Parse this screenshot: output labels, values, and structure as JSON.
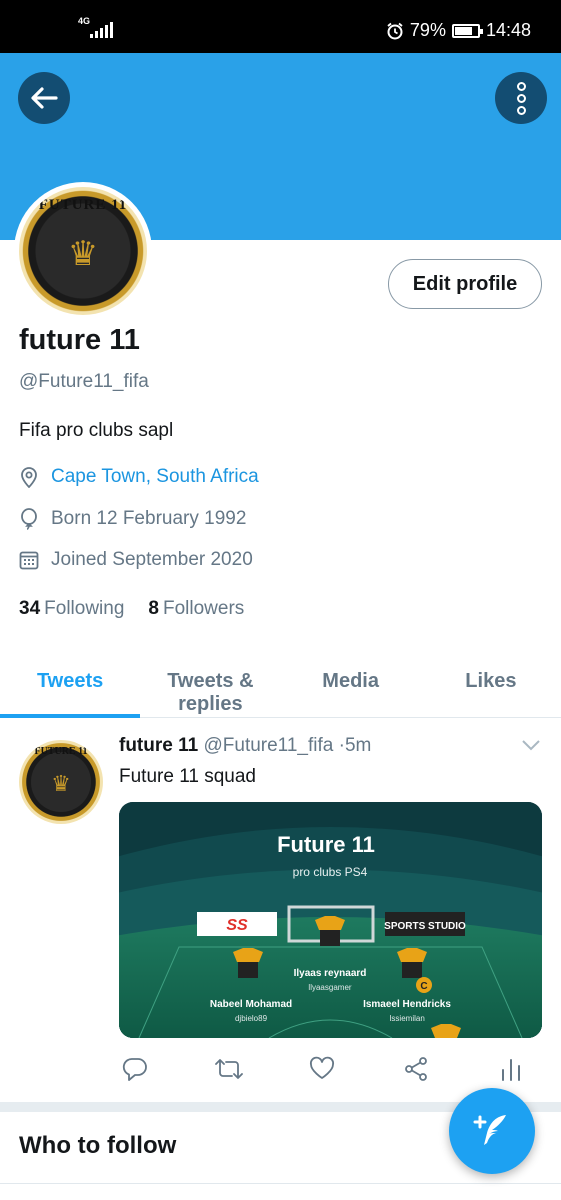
{
  "status_bar": {
    "network": "4G",
    "battery": "79%",
    "battery_level": 0.79,
    "time": "14:48"
  },
  "profile": {
    "name": "future 11",
    "handle": "@Future11_fifa",
    "bio": "Fifa pro clubs sapl",
    "location": "Cape Town, South Africa",
    "born": "Born 12 February 1992",
    "joined": "Joined September 2020",
    "following_count": "34",
    "following_label": "Following",
    "followers_count": "8",
    "followers_label": "Followers",
    "edit_button": "Edit profile",
    "avatar_text": "FUTURE 11"
  },
  "tabs": [
    {
      "label": "Tweets",
      "active": true
    },
    {
      "label": "Tweets & replies",
      "active": false
    },
    {
      "label": "Media",
      "active": false
    },
    {
      "label": "Likes",
      "active": false
    }
  ],
  "tweet": {
    "author": "future 11",
    "handle": "@Future11_fifa",
    "separator": "·",
    "time": "5m",
    "text": "Future 11 squad",
    "media": {
      "title": "Future 11",
      "subtitle": "pro clubs PS4",
      "sponsor_left": "SS",
      "sponsor_right": "SPORTS STUDIO",
      "players": [
        {
          "name": "Ilyaas reynaard",
          "tag": "llyaasgamer"
        },
        {
          "name": "Nabeel Mohamad",
          "tag": "djbielo89"
        },
        {
          "name": "Ismaeel Hendricks",
          "tag": "Issiemilan"
        }
      ],
      "captain_badge": "C"
    }
  },
  "who_to_follow": "Who to follow",
  "icons": {
    "back": "arrow-left-icon",
    "more": "more-vertical-icon",
    "location": "location-pin-icon",
    "born": "balloon-icon",
    "joined": "calendar-icon",
    "reply": "reply-icon",
    "retweet": "retweet-icon",
    "like": "heart-icon",
    "share": "share-icon",
    "analytics": "analytics-icon",
    "compose": "compose-tweet-icon"
  },
  "colors": {
    "header": "#2aa1e8",
    "accent": "#1da1f2",
    "link": "#1b95e0",
    "muted": "#657786"
  }
}
